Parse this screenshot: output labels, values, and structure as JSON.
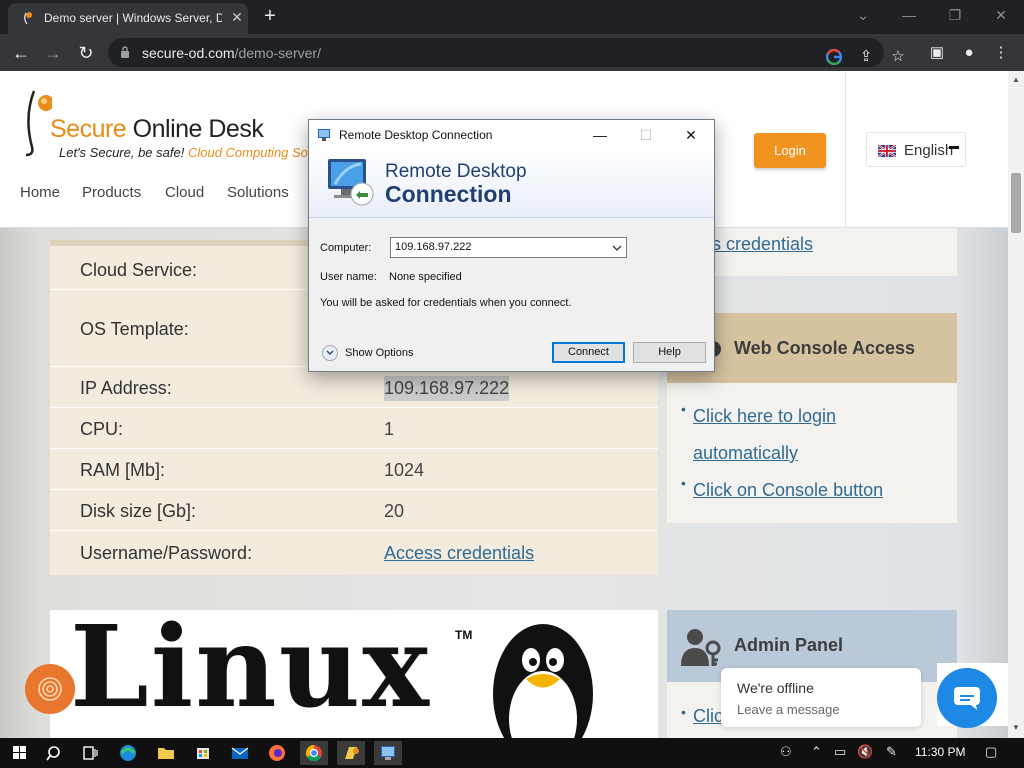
{
  "browser": {
    "tab_title": "Demo server | Windows Server, D",
    "url_host": "secure-od.com",
    "url_path": "/demo-server/"
  },
  "site": {
    "logo_word1": "Secure",
    "logo_word2": " Online Desk",
    "tagline_1": "Let's Secure, be safe!",
    "tagline_2": " Cloud Computing So",
    "menu": [
      "Home",
      "Products",
      "Cloud",
      "Solutions"
    ],
    "login_label": "Login",
    "language": "English"
  },
  "details": {
    "rows": [
      {
        "label": "Cloud Service:",
        "value": ""
      },
      {
        "label": "OS Template:",
        "value": ""
      },
      {
        "label": "IP Address:",
        "value": "109.168.97.222"
      },
      {
        "label": "CPU:",
        "value": "1"
      },
      {
        "label": "RAM [Mb]:",
        "value": "1024"
      },
      {
        "label": "Disk size [Gb]:",
        "value": "20"
      },
      {
        "label": "Username/Password:",
        "value": "Access credentials"
      }
    ]
  },
  "sidebar": {
    "top_link": "ess credentials",
    "web_console_title": "Web Console Access",
    "web_console_links": [
      "Click here to login",
      "automatically",
      "Click on Console button"
    ],
    "admin_title": "Admin Panel",
    "admin_link": "Clic"
  },
  "linux_logo": {
    "word": "Linux",
    "tm": "TM"
  },
  "chat": {
    "offline_title": "We're offline",
    "offline_sub": "Leave a message"
  },
  "rdp": {
    "window_title": "Remote Desktop Connection",
    "banner_line1": "Remote Desktop",
    "banner_line2": "Connection",
    "computer_label": "Computer:",
    "computer_value": "109.168.97.222",
    "username_label": "User name:",
    "username_value": "None specified",
    "info": "You will be asked for credentials when you connect.",
    "show_options": "Show Options",
    "connect": "Connect",
    "help": "Help"
  },
  "taskbar": {
    "clock": "11:30 PM"
  },
  "colors": {
    "accent_orange": "#f3931f",
    "link_blue": "#2f6b94",
    "rdp_title_blue": "#1f3f74"
  }
}
